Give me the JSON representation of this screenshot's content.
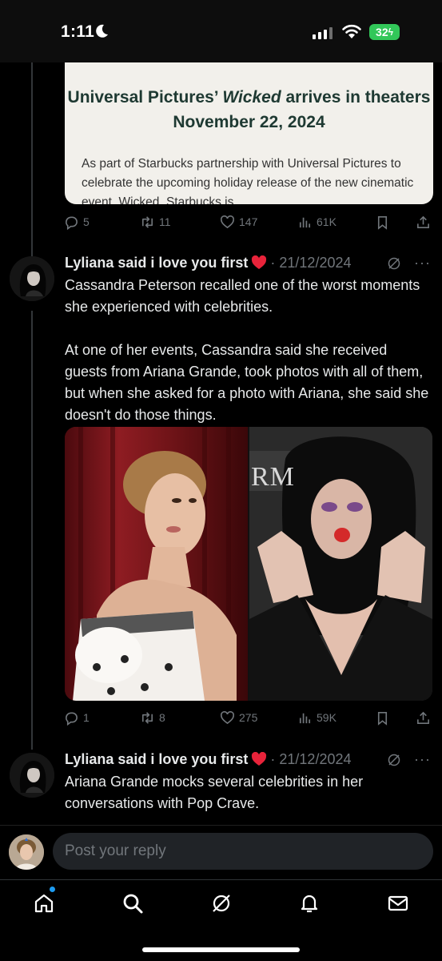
{
  "status_bar": {
    "time": "1:11",
    "battery": "32"
  },
  "article_card": {
    "title_part1": "Universal Pictures’ ",
    "title_italic": "Wicked",
    "title_part2": " arrives in theaters November 22, 2024",
    "body": "As part of Starbucks partnership with Universal Pictures to celebrate the upcoming holiday release of the new cinematic event, Wicked, Starbucks is"
  },
  "tweet0_actions": {
    "replies": "5",
    "reposts": "11",
    "likes": "147",
    "views": "61K"
  },
  "tweet1": {
    "author": "Lyliana said i love you first",
    "date": "· 21/12/2024",
    "more": "···",
    "text": "Cassandra Peterson recalled one of the worst moments she experienced with celebrities.\n\nAt one of her events, Cassandra said she received guests from Ariana Grande, took photos with all of them, but when she asked for a photo with Ariana, she said she doesn't do those things.",
    "photo_sign_text": "RM",
    "replies": "1",
    "reposts": "8",
    "likes": "275",
    "views": "59K"
  },
  "tweet2": {
    "author": "Lyliana said i love you first",
    "date": "· 21/12/2024",
    "more": "···",
    "text": "Ariana Grande mocks several celebrities in her conversations with Pop Crave."
  },
  "reply_bar": {
    "placeholder": "Post your reply"
  },
  "tab_bar": {
    "items": [
      "home-icon",
      "search-icon",
      "grok-icon",
      "notifications-icon",
      "messages-icon"
    ]
  },
  "colors": {
    "background": "#000000",
    "text_primary": "#e7e9ea",
    "text_secondary": "#71767b",
    "accent": "#1d9bf0",
    "card_title": "#1e3932"
  }
}
